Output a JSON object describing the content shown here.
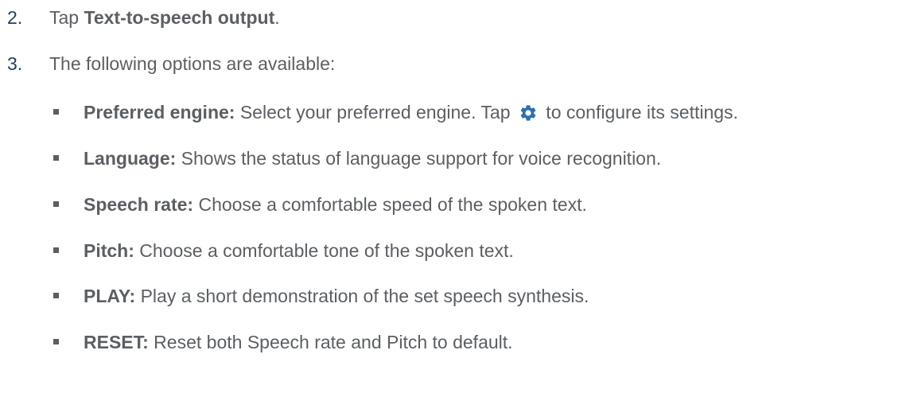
{
  "steps": [
    {
      "number": "2.",
      "prefix": "Tap ",
      "bold": "Text-to-speech output",
      "suffix": "."
    },
    {
      "number": "3.",
      "text": "The following options are available:"
    }
  ],
  "options": [
    {
      "term": "Preferred engine:",
      "desc_before_icon": " Select your preferred engine. Tap ",
      "icon": "gear-icon",
      "desc_after_icon": " to configure its settings."
    },
    {
      "term": "Language:",
      "desc": " Shows the status of language support for voice recognition."
    },
    {
      "term": "Speech rate:",
      "desc": " Choose a comfortable speed of the spoken text."
    },
    {
      "term": "Pitch:",
      "desc": " Choose a comfortable tone of the spoken text."
    },
    {
      "term": "PLAY:",
      "desc": " Play a short demonstration of the set speech synthesis."
    },
    {
      "term": "RESET:",
      "desc": " Reset both Speech rate and Pitch to default."
    }
  ],
  "colors": {
    "body_text": "#5b5f63",
    "step_number": "#1f3f66",
    "icon": "#2b6fb5"
  }
}
